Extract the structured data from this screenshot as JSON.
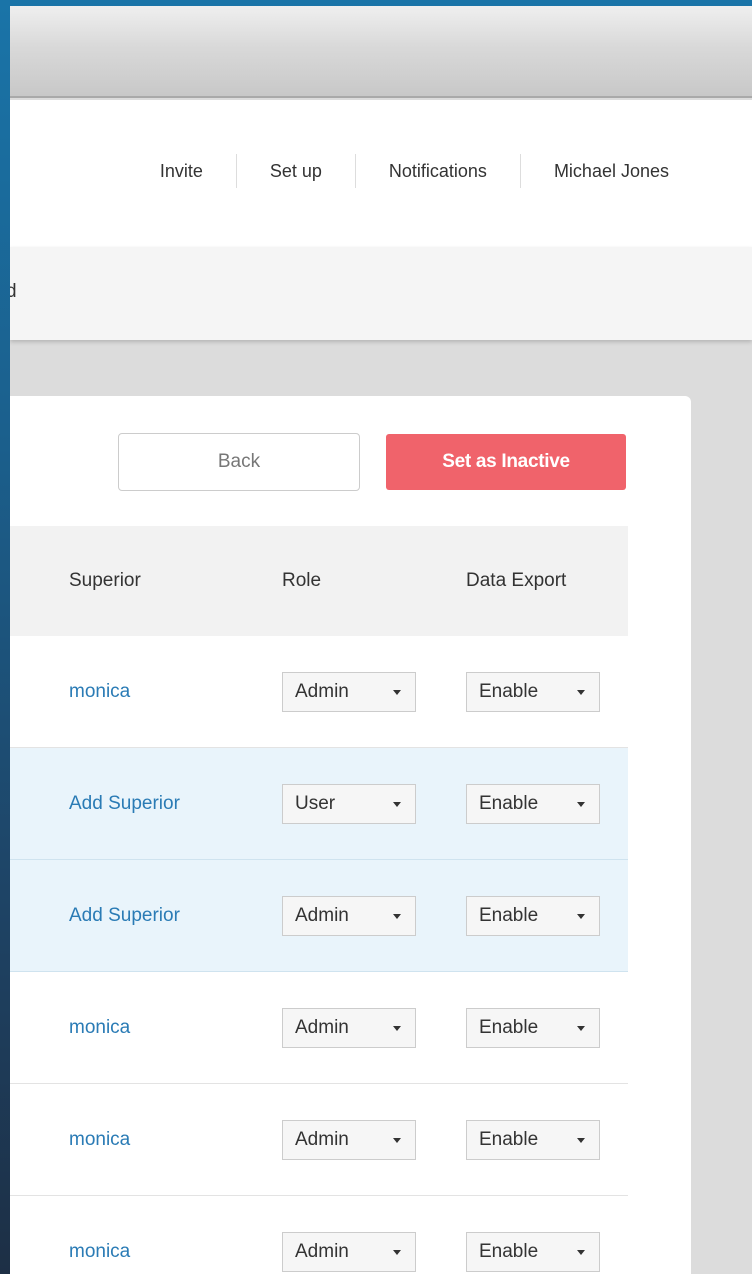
{
  "nav": {
    "links": [
      "Invite",
      "Set up",
      "Notifications",
      "Michael Jones"
    ]
  },
  "sub_header": {
    "text": "d"
  },
  "actions": {
    "back_label": "Back",
    "inactive_label": "Set as Inactive"
  },
  "table": {
    "headers": [
      "Superior",
      "Role",
      "Data Export"
    ],
    "rows": [
      {
        "superior": "monica",
        "role": "Admin",
        "export": "Enable",
        "selected": false
      },
      {
        "superior": "Add Superior",
        "role": "User",
        "export": "Enable",
        "selected": true
      },
      {
        "superior": "Add Superior",
        "role": "Admin",
        "export": "Enable",
        "selected": true
      },
      {
        "superior": "monica",
        "role": "Admin",
        "export": "Enable",
        "selected": false
      },
      {
        "superior": "monica",
        "role": "Admin",
        "export": "Enable",
        "selected": false
      },
      {
        "superior": "monica",
        "role": "Admin",
        "export": "Enable",
        "selected": false
      }
    ]
  },
  "colors": {
    "accent_link": "#2a7bb5",
    "danger_button": "#f0636b",
    "selected_row": "#e9f4fb"
  },
  "icons": {
    "dropdown": "chevron-down-icon"
  }
}
